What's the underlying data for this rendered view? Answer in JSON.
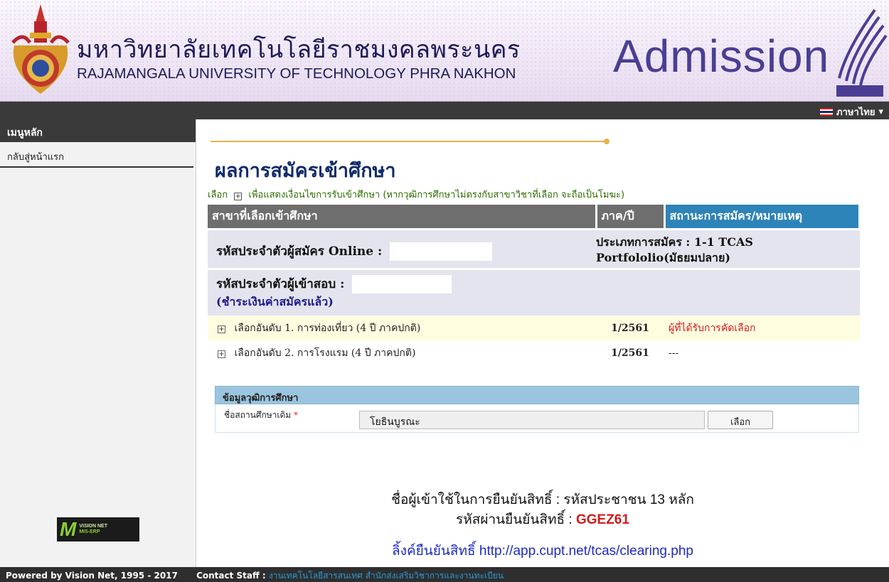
{
  "header": {
    "university_th": "มหาวิทยาลัยเทคโนโลยีราชมงคลพระนคร",
    "university_en": "RAJAMANGALA UNIVERSITY OF TECHNOLOGY PHRA NAKHON",
    "admission": "Admission",
    "language": "ภาษาไทย"
  },
  "sidebar": {
    "heading": "เมนูหลัก",
    "items": [
      {
        "label": "กลับสู่หน้าแรก"
      }
    ],
    "vision_logo": {
      "letter": "M",
      "line1": "VISION NET",
      "line2": "MIS-ERP"
    }
  },
  "main": {
    "title": "ผลการสมัครเข้าศึกษา",
    "condition_prefix": "เลือก",
    "condition_text": "เพื่อแสดงเงื่อนไขการรับเข้าศึกษา (หากวุฒิการศึกษาไม่ตรงกับสาขาวิชาที่เลือก จะถือเป็นโมฆะ)",
    "table": {
      "headers": [
        "สาขาที่เลือกเข้าศึกษา",
        "ภาค/ปี",
        "สถานะการสมัคร/หมายเหตุ"
      ],
      "online_id_label": "รหัสประจำตัวผู้สมัคร Online :",
      "application_type": "ประเภทการสมัคร : 1-1 TCAS Portfololio(มัธยมปลาย)",
      "exam_id_label": "รหัสประจำตัวผู้เข้าสอบ :",
      "paid_status": "(ชำระเงินค่าสมัครแล้ว)",
      "choices": [
        {
          "label": "เลือกอันดับ 1. การท่องเที่ยว (4 ปี ภาคปกติ)",
          "term": "1/2561",
          "status": "ผู้ที่ได้รับการคัดเลือก"
        },
        {
          "label": "เลือกอันดับ 2. การโรงแรม (4 ปี ภาคปกติ)",
          "term": "1/2561",
          "status": "---"
        }
      ]
    },
    "education": {
      "heading": "ข้อมูลวุฒิการศึกษา",
      "field_label": "ชื่อสถานศึกษาเดิม",
      "required_mark": "*",
      "field_value": "โยธินบูรณะ",
      "select_button": "เลือก"
    },
    "credentials": {
      "line1": "ชื่อผู้เข้าใช้ในการยืนยันสิทธิ์ : รหัสประชาชน 13 หลัก",
      "line2_prefix": "รหัสผ่านยืนยันสิทธิ์ : ",
      "password": "GGEZ61",
      "line3": "ลิ้งค์ยืนยันสิทธิ์ http://app.cupt.net/tcas/clearing.php"
    }
  },
  "footer": {
    "powered": "Powered by Vision Net, 1995 - 2017",
    "contact_label": "Contact Staff :",
    "contact_link": "งานเทคโนโลยีสารสนเทศ สำนักส่งเสริมวิชาการและงานทะเบียน"
  },
  "colors": {
    "accent_blue": "#2d84b8",
    "header_gray": "#6e6e6e",
    "title_navy": "#0f2a6b",
    "status_red": "#d21b1b",
    "link_blue": "#1e2ac5"
  }
}
